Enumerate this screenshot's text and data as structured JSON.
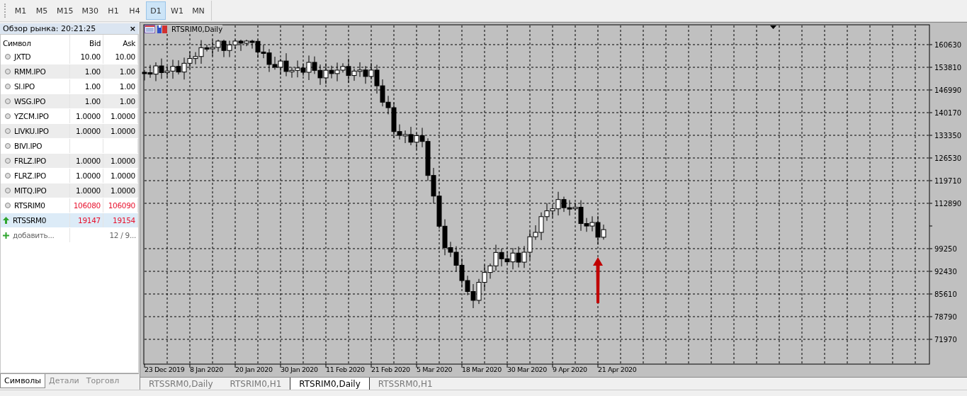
{
  "toolbar": {
    "periods": [
      {
        "label": "M1",
        "selected": false
      },
      {
        "label": "M5",
        "selected": false
      },
      {
        "label": "M15",
        "selected": false
      },
      {
        "label": "M30",
        "selected": false
      },
      {
        "label": "H1",
        "selected": false
      },
      {
        "label": "H4",
        "selected": false
      },
      {
        "label": "D1",
        "selected": true
      },
      {
        "label": "W1",
        "selected": false
      },
      {
        "label": "MN",
        "selected": false
      }
    ]
  },
  "market_watch": {
    "title": "Обзор рынка: 20:21:25",
    "close": "×",
    "columns": [
      "Символ",
      "Bid",
      "Ask"
    ],
    "rows": [
      {
        "symbol": "JXTD",
        "bid": "10.00",
        "ask": "10.00",
        "kind": "dot",
        "selected": false
      },
      {
        "symbol": "RMM.IPO",
        "bid": "1.00",
        "ask": "1.00",
        "kind": "dot",
        "selected": false
      },
      {
        "symbol": "SI.IPO",
        "bid": "1.00",
        "ask": "1.00",
        "kind": "dot",
        "selected": false
      },
      {
        "symbol": "WSG.IPO",
        "bid": "1.00",
        "ask": "1.00",
        "kind": "dot",
        "selected": false
      },
      {
        "symbol": "YZCM.IPO",
        "bid": "1.0000",
        "ask": "1.0000",
        "kind": "dot",
        "selected": false
      },
      {
        "symbol": "LIVKU.IPO",
        "bid": "1.0000",
        "ask": "1.0000",
        "kind": "dot",
        "selected": false
      },
      {
        "symbol": "BIVI.IPO",
        "kind": "dot",
        "selected": false
      },
      {
        "symbol": "FRLZ.IPO",
        "bid": "1.0000",
        "ask": "1.0000",
        "kind": "dot",
        "selected": false
      },
      {
        "symbol": "FLRZ.IPO",
        "bid": "1.0000",
        "ask": "1.0000",
        "kind": "dot",
        "selected": false
      },
      {
        "symbol": "MITQ.IPO",
        "bid": "1.0000",
        "ask": "1.0000",
        "kind": "dot",
        "selected": false
      },
      {
        "symbol": "RTSRIM0",
        "bid": "106080",
        "ask": "106090",
        "kind": "dot",
        "color": "#e8112d",
        "selected": false
      },
      {
        "symbol": "RTSSRM0",
        "bid": "19147",
        "ask": "19154",
        "kind": "up",
        "color": "#e8112d",
        "selected": true
      }
    ],
    "add": {
      "label": "добавить...",
      "count": "12 / 9..."
    },
    "tabs": [
      {
        "label": "Символы",
        "selected": true
      },
      {
        "label": "Детали",
        "selected": false
      },
      {
        "label": "Торговл",
        "selected": false
      }
    ]
  },
  "chart": {
    "title": "RTSRIM0,Daily",
    "price_ticks": [
      {
        "kind": "labeled",
        "label": "160630"
      },
      {
        "kind": "labeled",
        "label": "153810"
      },
      {
        "kind": "labeled",
        "label": "146990"
      },
      {
        "kind": "labeled",
        "label": "140170"
      },
      {
        "kind": "labeled",
        "label": "133350"
      },
      {
        "kind": "labeled",
        "label": "126530"
      },
      {
        "kind": "labeled",
        "label": "119710"
      },
      {
        "kind": "labeled",
        "label": "112890"
      },
      {
        "kind": "tick"
      },
      {
        "kind": "labeled",
        "label": "99250"
      },
      {
        "kind": "labeled",
        "label": "92430"
      },
      {
        "kind": "labeled",
        "label": "85610"
      },
      {
        "kind": "labeled",
        "label": "78790"
      },
      {
        "kind": "labeled",
        "label": "71970"
      }
    ],
    "date_labels": [
      "23 Dec 2019",
      "8 Jan 2020",
      "20 Jan 2020",
      "30 Jan 2020",
      "11 Feb 2020",
      "21 Feb 2020",
      "5 Mar 2020",
      "18 Mar 2020",
      "30 Mar 2020",
      "9 Apr 2020",
      "21 Apr 2020"
    ]
  },
  "chart_tabs": [
    {
      "label": "RTSSRM0,Daily",
      "selected": false
    },
    {
      "label": "RTSRIM0,H1",
      "selected": false
    },
    {
      "label": "RTSRIM0,Daily",
      "selected": true
    },
    {
      "label": "RTSSRM0,H1",
      "selected": false
    }
  ]
}
